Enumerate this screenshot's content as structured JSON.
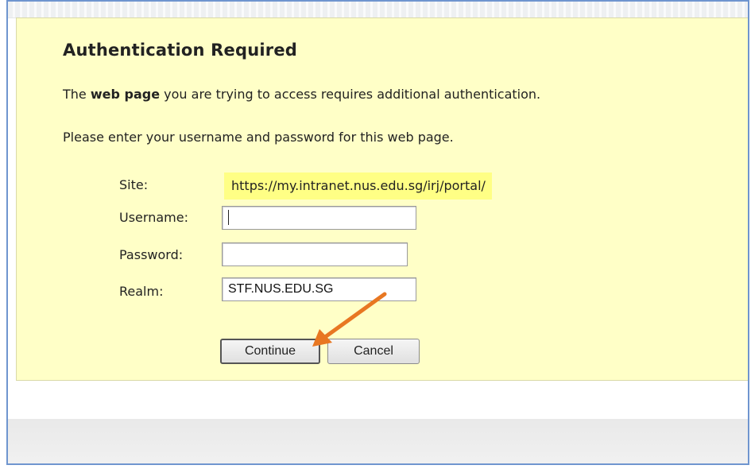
{
  "dialog": {
    "title": "Authentication Required",
    "message_prefix": "The ",
    "message_bold": "web page",
    "message_suffix": " you are trying to access requires additional authentication.",
    "instruction": "Please enter your username and password for this web page."
  },
  "form": {
    "site_label": "Site:",
    "site_value": "https://my.intranet.nus.edu.sg/irj/portal/",
    "username_label": "Username:",
    "username_value": "",
    "password_label": "Password:",
    "password_value": "",
    "realm_label": "Realm:",
    "realm_value": "STF.NUS.EDU.SG"
  },
  "buttons": {
    "continue_label": "Continue",
    "cancel_label": "Cancel"
  },
  "annotation": {
    "arrow_icon": "pointer-arrow-icon",
    "arrow_color": "#e87722"
  },
  "colors": {
    "panel_background": "#ffffc7",
    "site_highlight": "#ffff85",
    "frame_border": "#6f95cf"
  }
}
